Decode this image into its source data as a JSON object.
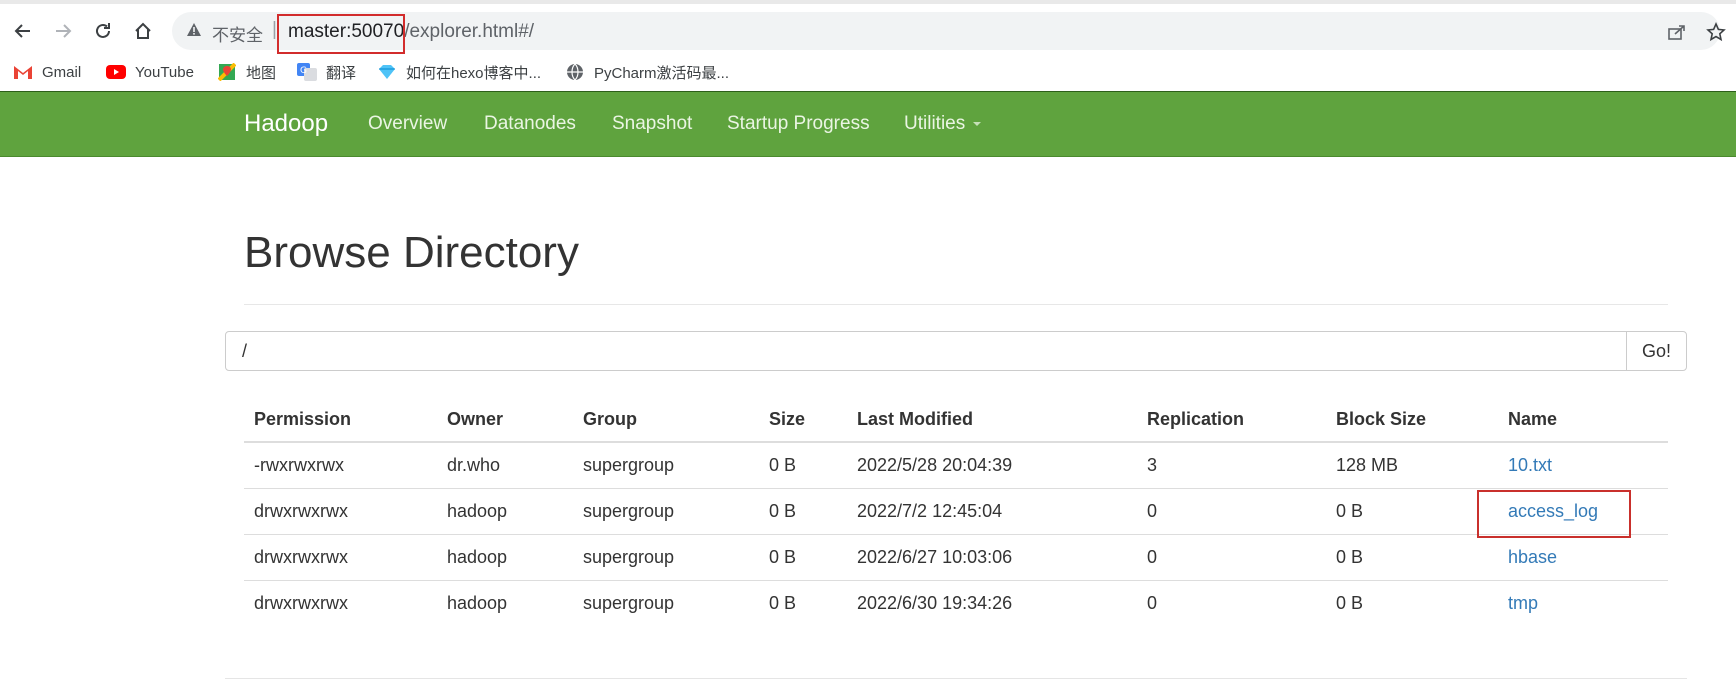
{
  "browser": {
    "security_label": "不安全",
    "separator": "|",
    "url_host": "master:50070",
    "url_rest": "/explorer.html#/",
    "bookmarks": [
      {
        "label": "Gmail",
        "icon": "gmail-icon"
      },
      {
        "label": "YouTube",
        "icon": "youtube-icon"
      },
      {
        "label": "地图",
        "icon": "maps-icon"
      },
      {
        "label": "翻译",
        "icon": "translate-icon"
      },
      {
        "label": "如何在hexo博客中...",
        "icon": "diamond-icon"
      },
      {
        "label": "PyCharm激活码最...",
        "icon": "globe-icon"
      }
    ]
  },
  "navbar": {
    "brand": "Hadoop",
    "items": [
      "Overview",
      "Datanodes",
      "Snapshot",
      "Startup Progress",
      "Utilities"
    ]
  },
  "page": {
    "title": "Browse Directory",
    "path_value": "/",
    "go_label": "Go!"
  },
  "table": {
    "headers": [
      "Permission",
      "Owner",
      "Group",
      "Size",
      "Last Modified",
      "Replication",
      "Block Size",
      "Name"
    ],
    "rows": [
      [
        "-rwxrwxrwx",
        "dr.who",
        "supergroup",
        "0 B",
        "2022/5/28 20:04:39",
        "3",
        "128 MB",
        "10.txt"
      ],
      [
        "drwxrwxrwx",
        "hadoop",
        "supergroup",
        "0 B",
        "2022/7/2 12:45:04",
        "0",
        "0 B",
        "access_log"
      ],
      [
        "drwxrwxrwx",
        "hadoop",
        "supergroup",
        "0 B",
        "2022/6/27 10:03:06",
        "0",
        "0 B",
        "hbase"
      ],
      [
        "drwxrwxrwx",
        "hadoop",
        "supergroup",
        "0 B",
        "2022/6/30 19:34:26",
        "0",
        "0 B",
        "tmp"
      ]
    ]
  },
  "colors": {
    "navbar_bg": "#5fa33e",
    "link": "#337ab7",
    "annotation_red": "#d22c2c"
  }
}
